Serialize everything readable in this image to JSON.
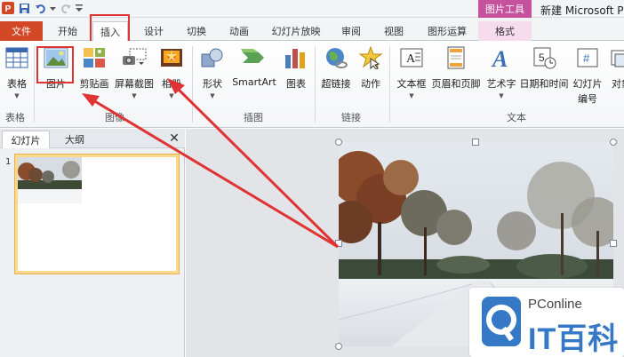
{
  "app": {
    "window_title": "新建 Microsoft P",
    "app_icon_letter": "P",
    "context_tab_group": "图片工具"
  },
  "tabs": [
    {
      "id": "file",
      "label": "文件"
    },
    {
      "id": "home",
      "label": "开始"
    },
    {
      "id": "insert",
      "label": "插入",
      "selected": true
    },
    {
      "id": "design",
      "label": "设计"
    },
    {
      "id": "transitions",
      "label": "切换"
    },
    {
      "id": "animations",
      "label": "动画"
    },
    {
      "id": "slideshow",
      "label": "幻灯片放映"
    },
    {
      "id": "review",
      "label": "审阅"
    },
    {
      "id": "view",
      "label": "视图"
    },
    {
      "id": "shape-format",
      "label": "图形运算"
    },
    {
      "id": "format",
      "label": "格式"
    }
  ],
  "ribbon": {
    "buttons": [
      {
        "id": "table",
        "label": "表格",
        "icon": "table-icon"
      },
      {
        "id": "picture",
        "label": "图片",
        "icon": "picture-icon"
      },
      {
        "id": "clipart",
        "label": "剪贴画",
        "icon": "clipart-icon"
      },
      {
        "id": "screenshot",
        "label": "屏幕截图",
        "icon": "screenshot-icon"
      },
      {
        "id": "album",
        "label": "相册",
        "icon": "photo-album-icon"
      },
      {
        "id": "shapes",
        "label": "形状",
        "icon": "shapes-icon"
      },
      {
        "id": "smartart",
        "label": "SmartArt",
        "icon": "smartart-icon"
      },
      {
        "id": "chart",
        "label": "图表",
        "icon": "chart-icon"
      },
      {
        "id": "hyperlink",
        "label": "超链接",
        "icon": "hyperlink-icon"
      },
      {
        "id": "action",
        "label": "动作",
        "icon": "action-icon"
      },
      {
        "id": "textbox",
        "label": "文本框",
        "icon": "textbox-icon"
      },
      {
        "id": "header-footer",
        "label": "页眉和页脚",
        "icon": "header-footer-icon"
      },
      {
        "id": "wordart",
        "label": "艺术字",
        "icon": "wordart-icon"
      },
      {
        "id": "datetime",
        "label": "日期和时间",
        "icon": "datetime-icon"
      },
      {
        "id": "slide-number",
        "label": "幻灯片",
        "label2": "编号",
        "icon": "slide-number-icon"
      },
      {
        "id": "object",
        "label": "对象",
        "icon": "object-icon"
      }
    ],
    "groups": [
      {
        "id": "tables",
        "label": "表格"
      },
      {
        "id": "images",
        "label": "图像"
      },
      {
        "id": "illustrations",
        "label": "插图"
      },
      {
        "id": "links",
        "label": "链接"
      },
      {
        "id": "text",
        "label": "文本"
      }
    ]
  },
  "slides_panel": {
    "tab_slides": "幻灯片",
    "tab_outline": "大纲",
    "close_glyph": "✕",
    "slide_number": "1"
  },
  "watermark": {
    "subtitle": "PConline",
    "main": "IT百科"
  },
  "colors": {
    "file_tab": "#d24726",
    "context_tab": "#c6529d",
    "highlight_red": "#e03434",
    "watermark_blue": "#3478c6"
  }
}
